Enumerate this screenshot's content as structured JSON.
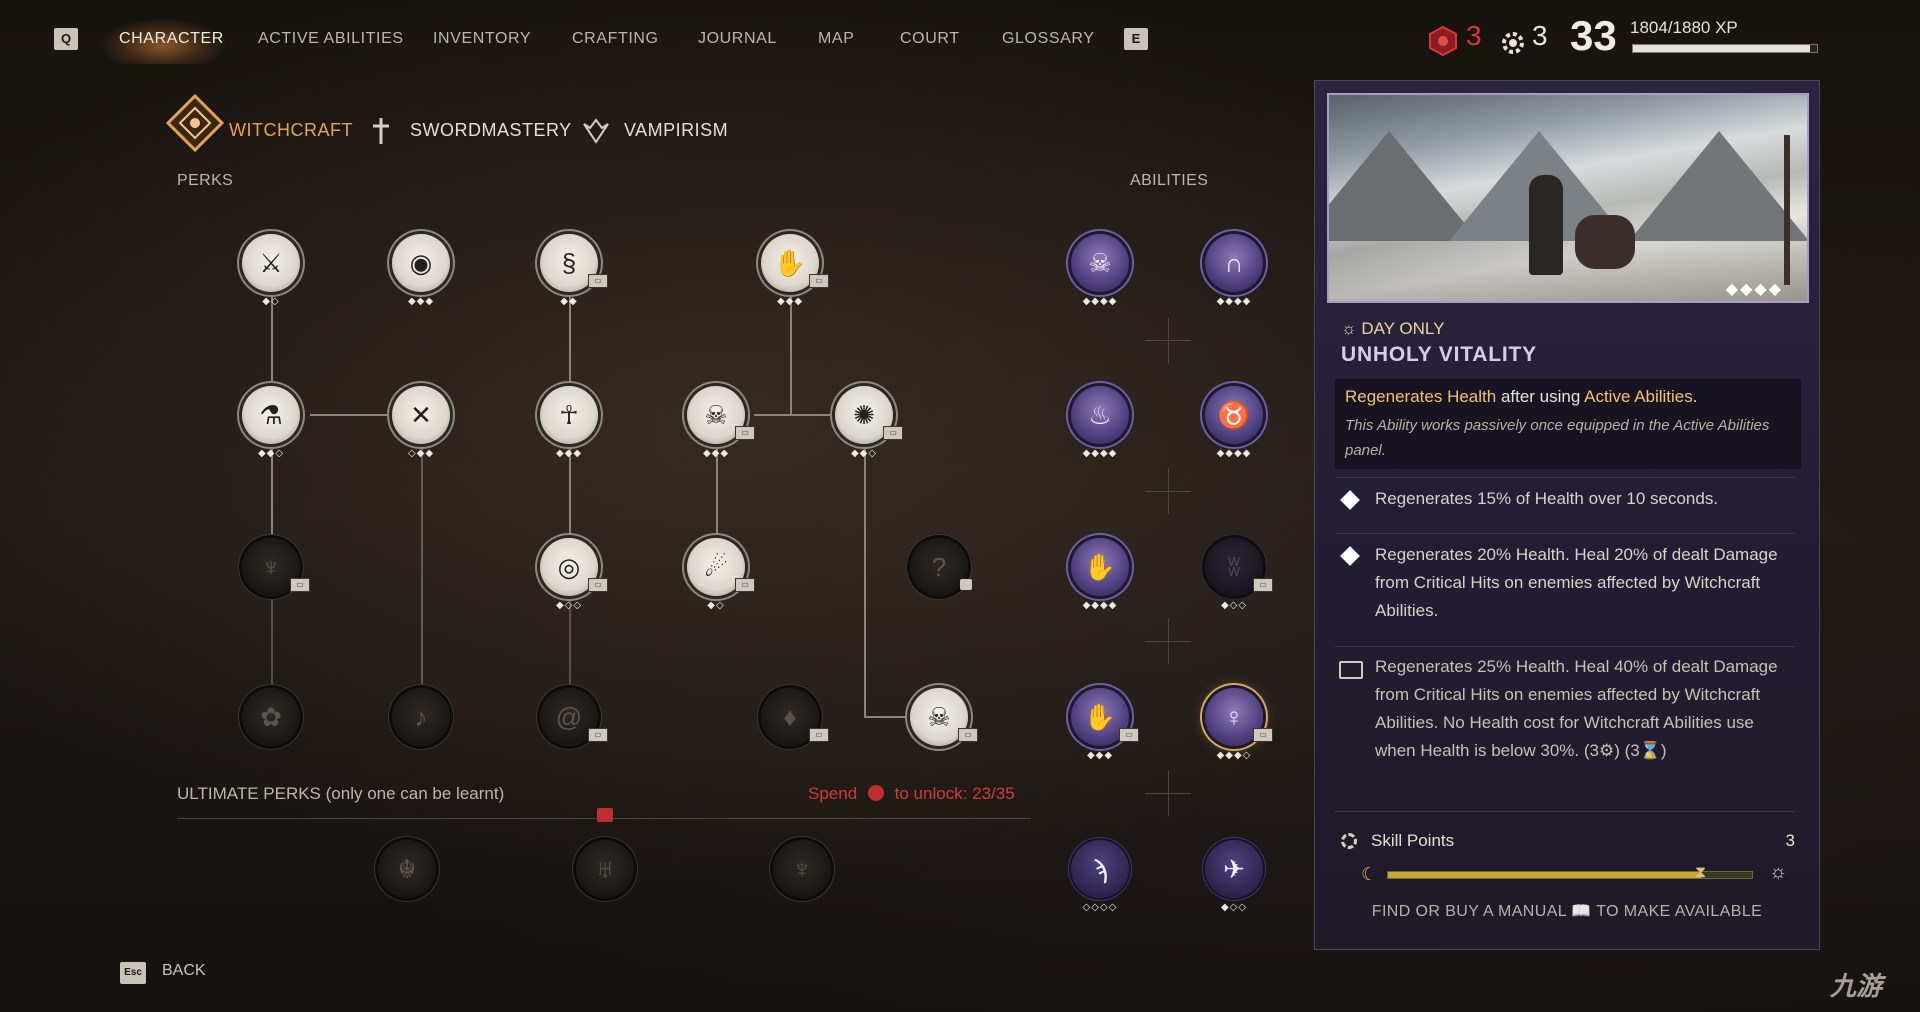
{
  "nav": {
    "left_key": "Q",
    "right_key": "E",
    "items": [
      "CHARACTER",
      "ACTIVE ABILITIES",
      "INVENTORY",
      "CRAFTING",
      "JOURNAL",
      "MAP",
      "COURT",
      "GLOSSARY"
    ],
    "active": "CHARACTER"
  },
  "stats": {
    "red_points": "3",
    "skill_points": "3",
    "level": "33",
    "xp": "1804/1880 XP",
    "xp_progress": 0.96
  },
  "trees": {
    "tabs": [
      "WITCHCRAFT",
      "SWORDMASTERY",
      "VAMPIRISM"
    ],
    "active": "WITCHCRAFT"
  },
  "sections": {
    "perks": "PERKS",
    "abilities": "ABILITIES",
    "ultimate": "ULTIMATE PERKS (only one can be learnt)",
    "spend_prefix": "Spend",
    "spend_suffix": "to unlock: 23/35"
  },
  "perks": [
    {
      "icon": "dagger-slash-icon",
      "pips": "◆◇",
      "state": "learned"
    },
    {
      "icon": "eye-icon",
      "pips": "◆◆◆",
      "state": "learned"
    },
    {
      "icon": "serpent-icon",
      "pips": "◆◆",
      "state": "learned",
      "book": true
    },
    {
      "icon": "open-hand-icon",
      "pips": "◆◆◆",
      "state": "learned",
      "book": true
    },
    {
      "icon": "mortar-icon",
      "pips": "◆◆◇",
      "state": "learned"
    },
    {
      "icon": "crossed-bones-icon",
      "pips": "◇◆◆",
      "state": "learned"
    },
    {
      "icon": "ankh-icon",
      "pips": "◆◆◆",
      "state": "learned"
    },
    {
      "icon": "skull-crossbones-icon",
      "pips": "◆◆◆",
      "state": "learned",
      "book": true
    },
    {
      "icon": "burst-icon",
      "pips": "◆◆◇",
      "state": "learned",
      "book": true
    },
    {
      "icon": "totem-icon",
      "pips": "",
      "state": "locked",
      "book": true
    },
    {
      "icon": "eye-rune-icon",
      "pips": "◆◇◇",
      "state": "learned",
      "book": true
    },
    {
      "icon": "flame-spiral-icon",
      "pips": "◆◇",
      "state": "learned",
      "book": true
    },
    {
      "icon": "question-icon",
      "pips": "",
      "state": "locked",
      "lock": true
    },
    {
      "icon": "plant-icon",
      "pips": "",
      "state": "locked"
    },
    {
      "icon": "horn-icon",
      "pips": "",
      "state": "locked"
    },
    {
      "icon": "vortex-icon",
      "pips": "",
      "state": "locked",
      "book": true
    },
    {
      "icon": "drop-icon",
      "pips": "",
      "state": "locked",
      "book": true
    },
    {
      "icon": "flaming-skull-icon",
      "pips": "",
      "state": "learned",
      "book": true
    }
  ],
  "ultimates": [
    {
      "icon": "ultimate-beast-icon"
    },
    {
      "icon": "ultimate-demon-icon"
    },
    {
      "icon": "ultimate-dragon-icon"
    }
  ],
  "abilities": [
    {
      "icon": "skull-ability-icon",
      "pips": "◆◆◆◆"
    },
    {
      "icon": "tombstone-ability-icon",
      "pips": "◆◆◆◆"
    },
    {
      "icon": "fire-ability-icon",
      "pips": "◆◆◆◆"
    },
    {
      "icon": "beast-ability-icon",
      "pips": "◆◆◆◆"
    },
    {
      "icon": "claw-ability-icon",
      "pips": "◆◆◆◆"
    },
    {
      "icon": "bat-ability-icon",
      "pips": "◆◇◇",
      "dark": true,
      "book": true
    },
    {
      "icon": "hand-ability-icon",
      "pips": "◆◆◆",
      "book": true
    },
    {
      "icon": "unholy-vitality-icon",
      "pips": "◆◆◆◇",
      "selected": true,
      "book": true
    },
    {
      "icon": "bird-ability-icon",
      "pips": "◇◇◇◇",
      "dim": true
    },
    {
      "icon": "runner-ability-icon",
      "pips": "◆◇◇",
      "dim": true
    }
  ],
  "detail": {
    "tag": "DAY ONLY",
    "title": "UNHOLY VITALITY",
    "page_dots": "◆◆◆◆",
    "desc_main_hl1": "Regenerates Health",
    "desc_main_mid": " after using ",
    "desc_main_hl2": "Active Abilities",
    "desc_main_end": ".",
    "desc_note": "This Ability works passively once equipped in the Active Abilities panel.",
    "levels": [
      "Regenerates 15% of Health over 10 seconds.",
      "Regenerates 20% Health. Heal 20% of dealt Damage from Critical Hits on enemies affected by Witchcraft Abilities.",
      "Regenerates 25% Health. Heal 40% of dealt Damage from Critical Hits on enemies affected by Witchcraft Abilities. No Health cost for Witchcraft Abilities use when Health is below 30%. (3⚙) (3⌛)"
    ],
    "skill_points_label": "Skill Points",
    "skill_points_value": "3",
    "skill_progress": 0.86,
    "manual_text": "FIND OR BUY A MANUAL 📖 TO MAKE AVAILABLE"
  },
  "footer": {
    "key": "Esc",
    "label": "BACK"
  },
  "watermark": "九游"
}
